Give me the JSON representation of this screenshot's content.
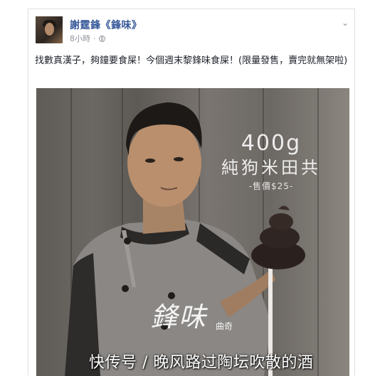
{
  "post": {
    "author": "謝霆鋒《鋒味》",
    "time": "8小時",
    "text": "找數真漢子，夠鐘要食屎！今個週末黎鋒味食屎！(限量發售，賣完就無架啦)",
    "icons": {
      "privacy": "globe-icon",
      "menu": "chevron-down-icon"
    }
  },
  "photo": {
    "weight": "400g",
    "product": "純狗米田共",
    "price": "-售價$25-",
    "brand": "鋒味",
    "brand_sub": "曲奇"
  },
  "watermark": "快传号 / 晚风路过陶坛吹散的酒"
}
